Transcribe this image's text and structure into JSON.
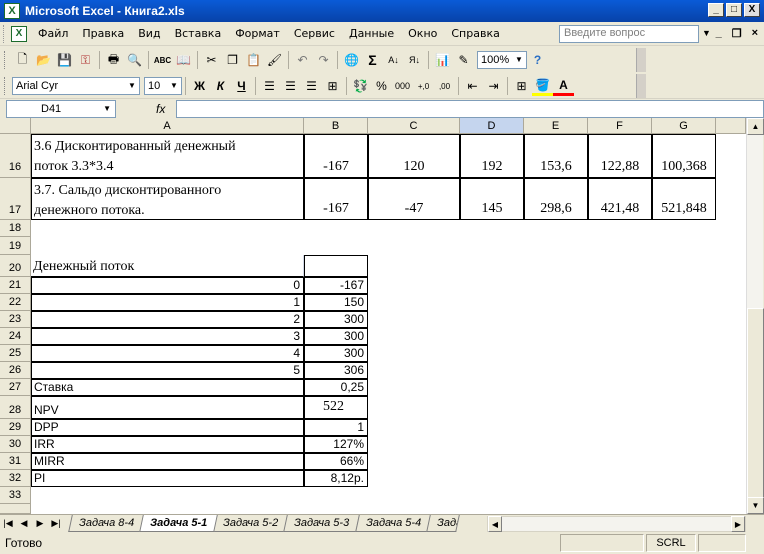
{
  "window": {
    "title": "Microsoft Excel - Книга2.xls",
    "minimize": "_",
    "maximize": "□",
    "close": "X"
  },
  "menu": {
    "items": [
      "Файл",
      "Правка",
      "Вид",
      "Вставка",
      "Формат",
      "Сервис",
      "Данные",
      "Окно",
      "Справка"
    ],
    "ask_placeholder": "Введите вопрос"
  },
  "toolbar": {
    "zoom": "100%",
    "font": "Arial Cyr",
    "size": "10",
    "bold": "Ж",
    "italic": "К",
    "underline": "Ч",
    "percent": "%",
    "thousands": "000",
    "sigma": "Σ"
  },
  "formula": {
    "cell_ref": "D41",
    "fx": "fx",
    "value": ""
  },
  "columns": [
    {
      "id": "A"
    },
    {
      "id": "B"
    },
    {
      "id": "C"
    },
    {
      "id": "D"
    },
    {
      "id": "E"
    },
    {
      "id": "F"
    },
    {
      "id": "G"
    }
  ],
  "rows": {
    "r16": {
      "num": "16",
      "a1": "3.6 Дисконтированный денежный",
      "a2": "поток 3.3*3.4",
      "b": "-167",
      "c": "120",
      "d": "192",
      "e": "153,6",
      "f": "122,88",
      "g": "100,368"
    },
    "r17": {
      "num": "17",
      "a1": "3.7. Сальдо дисконтированного",
      "a2": "денежного потока.",
      "b": "-167",
      "c": "-47",
      "d": "145",
      "e": "298,6",
      "f": "421,48",
      "g": "521,848"
    },
    "r18": {
      "num": "18"
    },
    "r19": {
      "num": "19"
    },
    "r20": {
      "num": "20",
      "a": "Денежный поток"
    },
    "cashflow": [
      {
        "num": "21",
        "a": "0",
        "b": "-167"
      },
      {
        "num": "22",
        "a": "1",
        "b": "150"
      },
      {
        "num": "23",
        "a": "2",
        "b": "300"
      },
      {
        "num": "24",
        "a": "3",
        "b": "300"
      },
      {
        "num": "25",
        "a": "4",
        "b": "300"
      },
      {
        "num": "26",
        "a": "5",
        "b": "306"
      }
    ],
    "r27": {
      "num": "27",
      "a": "Ставка",
      "b": "0,25"
    },
    "r28": {
      "num": "28",
      "a": "NPV",
      "b": "522"
    },
    "r29": {
      "num": "29",
      "a": "DPP",
      "b": "1"
    },
    "r30": {
      "num": "30",
      "a": "IRR",
      "b": "127%"
    },
    "r31": {
      "num": "31",
      "a": "MIRR",
      "b": "66%"
    },
    "r32": {
      "num": "32",
      "a": "PI",
      "b": "8,12р."
    },
    "r33": {
      "num": "33"
    }
  },
  "tabs": [
    "Задача 8-4",
    "Задача 5-1",
    "Задача 5-2",
    "Задача 5-3",
    "Задача 5-4",
    "Зада"
  ],
  "active_tab": "Задача 5-1",
  "status": {
    "text": "Готово",
    "scrl": "SCRL"
  }
}
